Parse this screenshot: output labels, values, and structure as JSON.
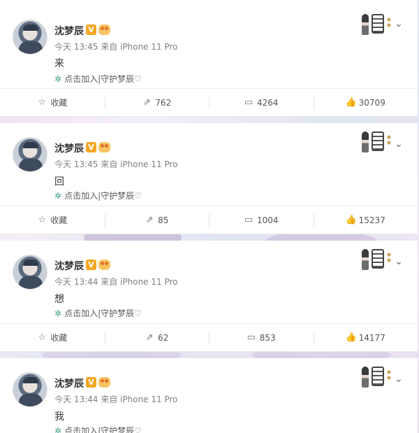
{
  "posts": [
    {
      "username": "沈梦辰",
      "verified_badge": "V",
      "time": "今天 13:45",
      "source": "来自 iPhone 11 Pro",
      "text": "来",
      "supertopic": "点击加入|守护梦辰♡",
      "actions": {
        "favorite": "收藏",
        "repost": "762",
        "comment": "4264",
        "like": "30709"
      }
    },
    {
      "username": "沈梦辰",
      "verified_badge": "V",
      "time": "今天 13:45",
      "source": "来自 iPhone 11 Pro",
      "text": "回",
      "supertopic": "点击加入|守护梦辰♡",
      "actions": {
        "favorite": "收藏",
        "repost": "85",
        "comment": "1004",
        "like": "15237"
      }
    },
    {
      "username": "沈梦辰",
      "verified_badge": "V",
      "time": "今天 13:44",
      "source": "来自 iPhone 11 Pro",
      "text": "想",
      "supertopic": "点击加入|守护梦辰♡",
      "actions": {
        "favorite": "收藏",
        "repost": "62",
        "comment": "853",
        "like": "14177"
      }
    },
    {
      "username": "沈梦辰",
      "verified_badge": "V",
      "time": "今天 13:44",
      "source": "来自 iPhone 11 Pro",
      "text": "我",
      "supertopic": "点击加入|守护梦辰♡"
    }
  ],
  "icons": {
    "favorite": "star-icon",
    "repost": "repost-icon",
    "comment": "comment-icon",
    "like": "thumbs-up-icon",
    "more": "chevron-down-icon",
    "supertopic": "supertopic-icon"
  },
  "colors": {
    "verified": "#f5a623",
    "supertopic_icon": "#3c9c8a",
    "text": "#333333",
    "meta": "#808080"
  }
}
